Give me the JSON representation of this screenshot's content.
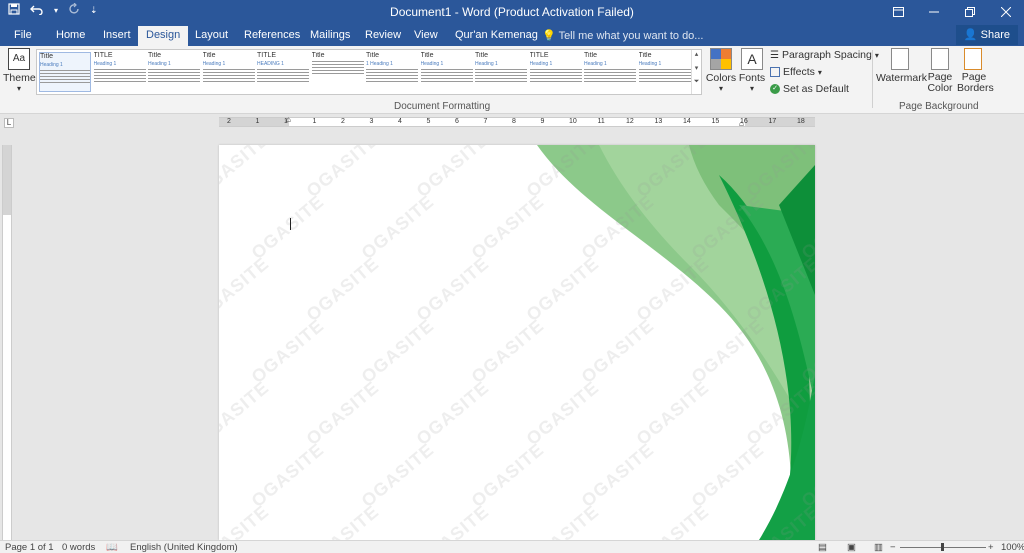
{
  "window": {
    "title": "Document1 - Word (Product Activation Failed)"
  },
  "qat": {
    "save_icon": "save-icon",
    "undo_icon": "undo-icon",
    "redo_icon": "redo-icon",
    "customize_icon": "customize-icon"
  },
  "tabs": [
    {
      "label": "File"
    },
    {
      "label": "Home"
    },
    {
      "label": "Insert"
    },
    {
      "label": "Design"
    },
    {
      "label": "Layout"
    },
    {
      "label": "References"
    },
    {
      "label": "Mailings"
    },
    {
      "label": "Review"
    },
    {
      "label": "View"
    },
    {
      "label": "Qur'an Kemenag"
    }
  ],
  "tell_me": "Tell me what you want to do...",
  "share": "Share",
  "ribbon": {
    "themes_label": "Themes",
    "colors_label": "Colors",
    "fonts_label": "Fonts",
    "paragraph_spacing": "Paragraph Spacing",
    "effects": "Effects",
    "set_as_default": "Set as Default",
    "watermark": "Watermark",
    "page_color": "Page Color",
    "page_borders": "Page Borders",
    "group_document_formatting": "Document Formatting",
    "group_page_background": "Page Background",
    "style_gallery": [
      {
        "title": "Title",
        "heading": "Heading 1"
      },
      {
        "title": "TITLE",
        "heading": "Heading 1"
      },
      {
        "title": "Title",
        "heading": "Heading 1"
      },
      {
        "title": "Title",
        "heading": "Heading 1"
      },
      {
        "title": "TITLE",
        "heading": "HEADING 1"
      },
      {
        "title": "Title",
        "heading": ""
      },
      {
        "title": "Title",
        "heading": "1 Heading 1"
      },
      {
        "title": "Title",
        "heading": "Heading 1"
      },
      {
        "title": "Title",
        "heading": "Heading 1"
      },
      {
        "title": "TITLE",
        "heading": "Heading 1"
      },
      {
        "title": "Title",
        "heading": "Heading 1"
      },
      {
        "title": "Title",
        "heading": "Heading 1"
      }
    ]
  },
  "ruler": {
    "ticks": [
      "2",
      "1",
      "1",
      "1",
      "2",
      "3",
      "4",
      "5",
      "6",
      "7",
      "8",
      "9",
      "10",
      "11",
      "12",
      "13",
      "14",
      "15",
      "16",
      "17",
      "18"
    ]
  },
  "document": {
    "watermark_text": "OGASITE"
  },
  "status": {
    "page": "Page 1 of 1",
    "words": "0 words",
    "language": "English (United Kingdom)",
    "zoom": "100%"
  },
  "colors": {
    "titlebar": "#2b579a",
    "leaf_light": "#8cc98a",
    "leaf_dark": "#0f9d3f"
  }
}
